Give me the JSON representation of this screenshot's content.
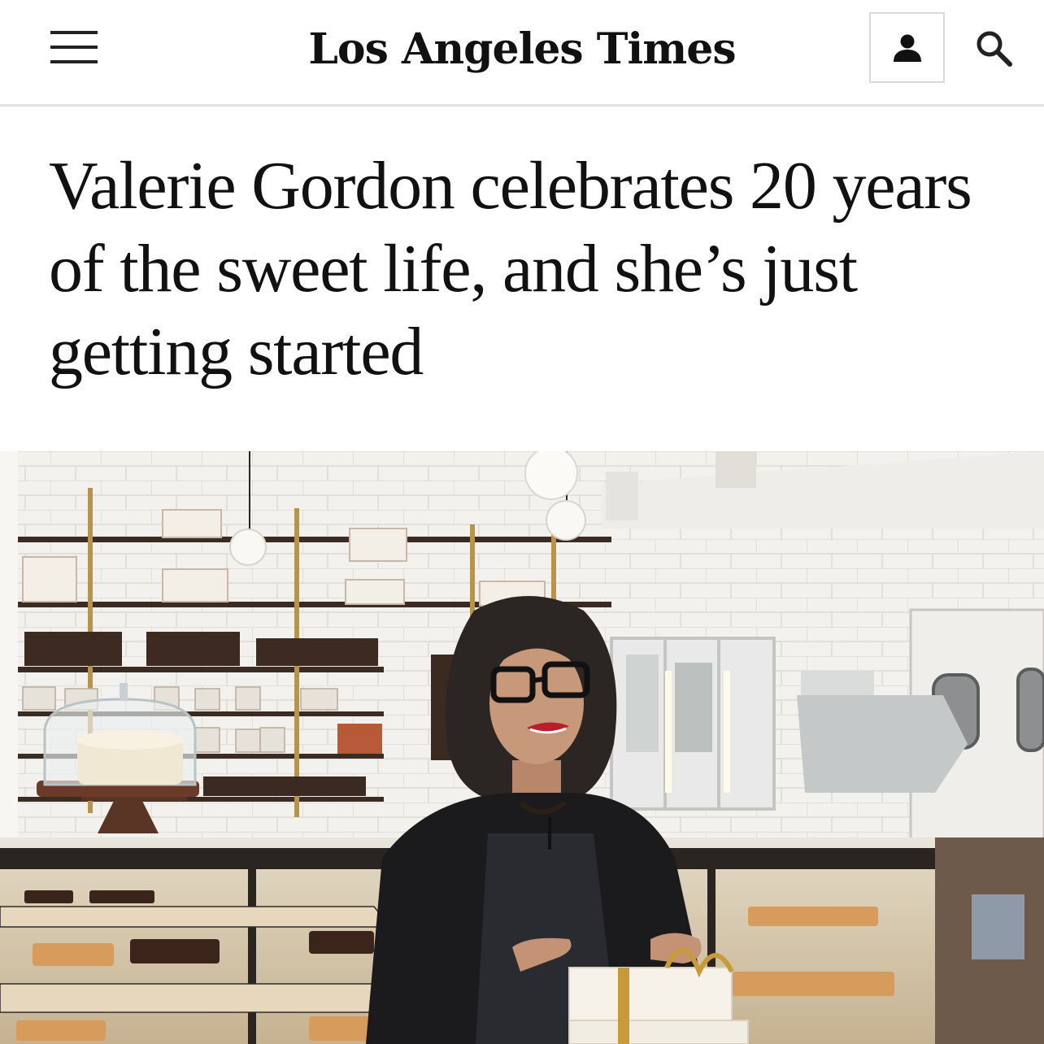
{
  "header": {
    "masthead": "Los Angeles Times",
    "menu_icon": "hamburger-menu-icon",
    "account_icon": "user-icon",
    "search_icon": "search-icon"
  },
  "article": {
    "headline": "Valerie Gordon celebrates 20 years of the sweet life, and she’s just getting started"
  },
  "colors": {
    "text": "#111111",
    "header_border": "#e3e3e3",
    "account_border": "#d9d9d9"
  }
}
